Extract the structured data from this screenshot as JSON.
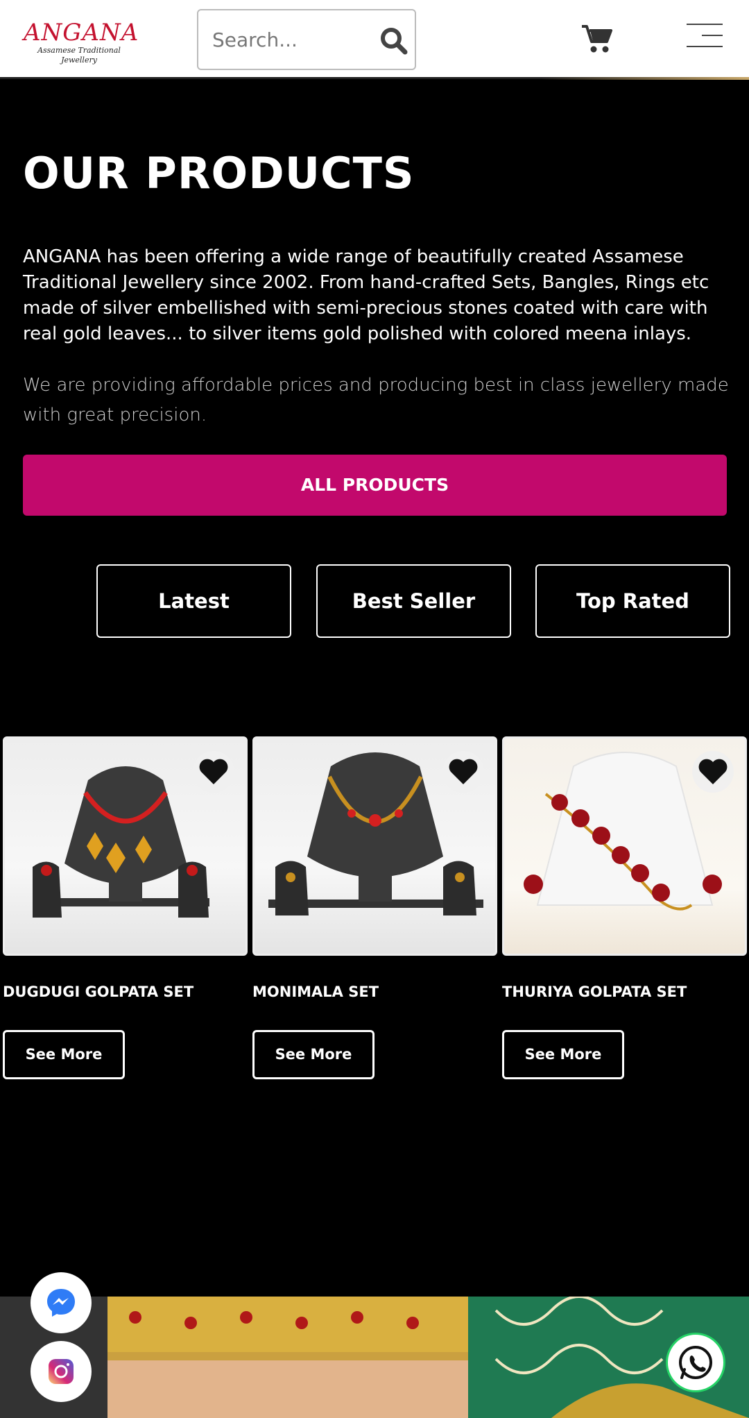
{
  "header": {
    "logo_title": "ANGANA",
    "logo_subtitle": "Assamese Traditional Jewellery",
    "search_placeholder": "Search...",
    "icons": [
      "search-icon",
      "cart-icon",
      "hamburger-menu-icon"
    ]
  },
  "hero": {
    "title": "OUR PRODUCTS",
    "intro": "ANGANA has been offering a wide range of beautifully created Assamese Traditional Jewellery since 2002. From hand-crafted Sets, Bangles, Rings etc made of silver embellished with semi-precious stones coated with care with real gold leaves... to silver items gold polished with colored meena inlays.",
    "intro_2": "We are providing affordable prices and producing best in class jewellery made with great precision.",
    "cta_label": "ALL PRODUCTS",
    "cta_color": "#c2096c"
  },
  "tabs": [
    {
      "label": "Latest"
    },
    {
      "label": "Best Seller"
    },
    {
      "label": "Top Rated"
    }
  ],
  "products": [
    {
      "name": "DUGDUGI GOLPATA SET",
      "button": "See More"
    },
    {
      "name": "MONIMALA SET",
      "button": "See More"
    },
    {
      "name": "THURIYA GOLPATA SET",
      "button": "See More"
    }
  ],
  "floating": [
    "messenger-icon",
    "instagram-icon",
    "whatsapp-icon"
  ]
}
